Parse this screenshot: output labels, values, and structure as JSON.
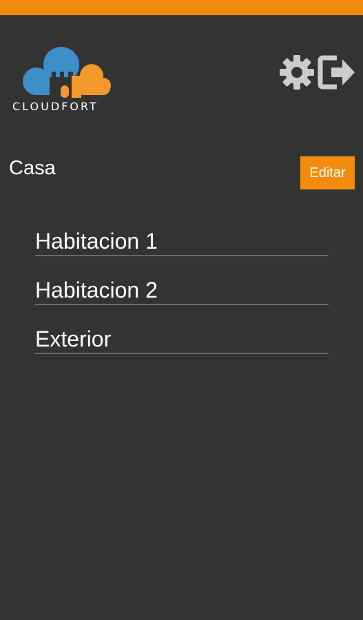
{
  "app": {
    "brand_name": "CLOUDFORT",
    "colors": {
      "accent": "#f28c0f",
      "logo_blue": "#3d8fc9",
      "logo_orange": "#f2992a",
      "background": "#333333",
      "icon_gray": "#cccccc"
    }
  },
  "header": {
    "settings_icon": "gear-icon",
    "logout_icon": "logout-icon"
  },
  "home": {
    "title": "Casa",
    "edit_label": "Editar",
    "rooms": [
      {
        "label": "Habitacion 1"
      },
      {
        "label": "Habitacion 2"
      },
      {
        "label": "Exterior"
      }
    ]
  }
}
